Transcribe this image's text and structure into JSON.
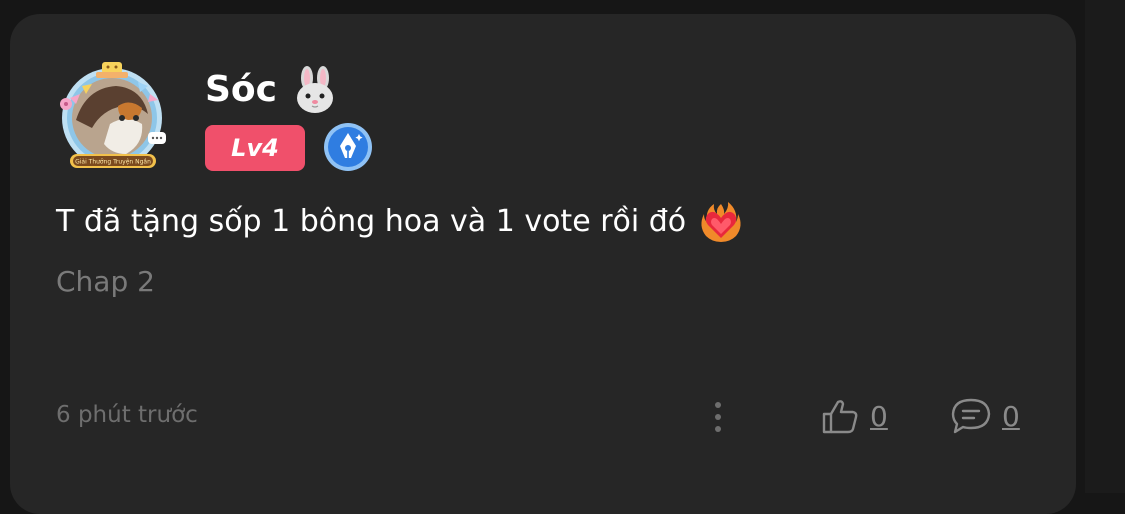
{
  "comment": {
    "username": "Sóc",
    "username_icon": "rabbit-face-icon",
    "level_label": "Lv4",
    "badge_icon": "fountain-pen-badge-icon",
    "text": "T đã tặng sốp 1 bông hoa và 1 vote rồi đó",
    "text_icon": "heart-on-fire-icon",
    "chapter": "Chap 2",
    "timestamp": "6 phút trước",
    "likes": "0",
    "replies": "0",
    "avatar_frame_caption": "Giải Thưởng Truyện Ngắn"
  },
  "colors": {
    "card_bg": "#262626",
    "page_bg": "#161616",
    "level_badge": "#f0506b",
    "pen_badge": "#2f7de1",
    "muted_text": "#7a7a7a"
  }
}
